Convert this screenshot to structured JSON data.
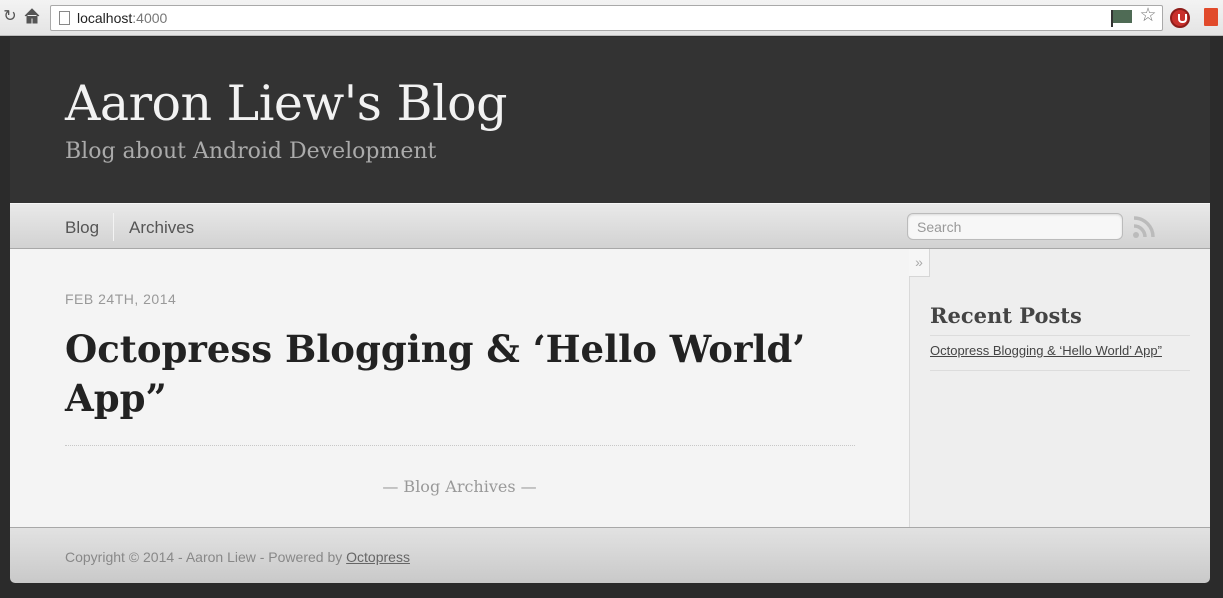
{
  "browser": {
    "url_host": "localhost",
    "url_port": ":4000",
    "icons": [
      "reload-icon",
      "home-icon",
      "page-icon",
      "flag-icon",
      "star-icon",
      "power-icon",
      "bookmark-icon"
    ]
  },
  "site": {
    "title": "Aaron Liew's Blog",
    "subtitle": "Blog about Android Development"
  },
  "nav": {
    "blog_label": "Blog",
    "archives_label": "Archives",
    "search_placeholder": "Search"
  },
  "post": {
    "date": "FEB 24TH, 2014",
    "title": "Octopress Blogging & ‘Hello World’ App”"
  },
  "archives_link": "— Blog Archives —",
  "sidebar": {
    "toggle": "»",
    "heading": "Recent Posts",
    "recent_posts": [
      "Octopress Blogging & ‘Hello World’ App”"
    ]
  },
  "footer": {
    "text": "Copyright © 2014 - Aaron Liew - Powered by ",
    "link_label": "Octopress"
  },
  "colors": {
    "header_bg": "#333333",
    "content_bg": "#f4f4f4",
    "sidebar_bg": "#eeeeee"
  }
}
